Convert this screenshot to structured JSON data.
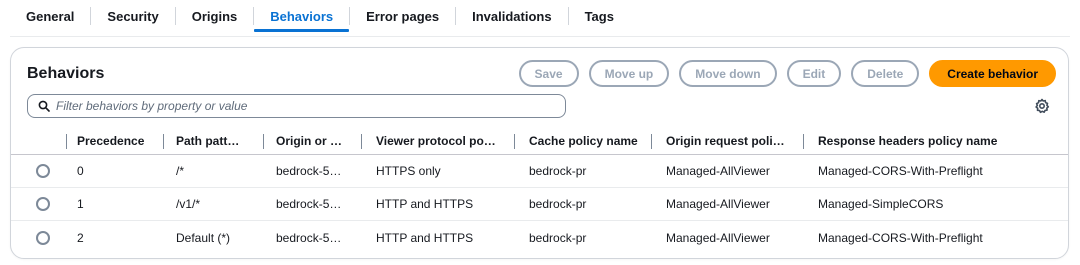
{
  "tabs": [
    {
      "label": "General",
      "active": false
    },
    {
      "label": "Security",
      "active": false
    },
    {
      "label": "Origins",
      "active": false
    },
    {
      "label": "Behaviors",
      "active": true
    },
    {
      "label": "Error pages",
      "active": false
    },
    {
      "label": "Invalidations",
      "active": false
    },
    {
      "label": "Tags",
      "active": false
    }
  ],
  "panel": {
    "title": "Behaviors",
    "buttons": {
      "save": "Save",
      "move_up": "Move up",
      "move_down": "Move down",
      "edit": "Edit",
      "delete": "Delete",
      "create": "Create behavior"
    },
    "filter": {
      "placeholder": "Filter behaviors by property or value",
      "value": ""
    }
  },
  "table": {
    "columns": [
      "Precedence",
      "Path patt…",
      "Origin or …",
      "Viewer protocol po…",
      "Cache policy name",
      "Origin request poli…",
      "Response headers policy name"
    ],
    "rows": [
      [
        "0",
        "/*",
        "bedrock-5…",
        "HTTPS only",
        "bedrock-pr",
        "Managed-AllViewer",
        "Managed-CORS-With-Preflight"
      ],
      [
        "1",
        "/v1/*",
        "bedrock-5…",
        "HTTP and HTTPS",
        "bedrock-pr",
        "Managed-AllViewer",
        "Managed-SimpleCORS"
      ],
      [
        "2",
        "Default (*)",
        "bedrock-5…",
        "HTTP and HTTPS",
        "bedrock-pr",
        "Managed-AllViewer",
        "Managed-CORS-With-Preflight"
      ]
    ]
  },
  "colors": {
    "accent": "#0972d3",
    "primary_button": "#ff9900",
    "disabled": "#9ba7b6"
  },
  "icons": {
    "filter": "search-icon",
    "preferences": "gear-icon",
    "row_select": "radio-icon"
  }
}
